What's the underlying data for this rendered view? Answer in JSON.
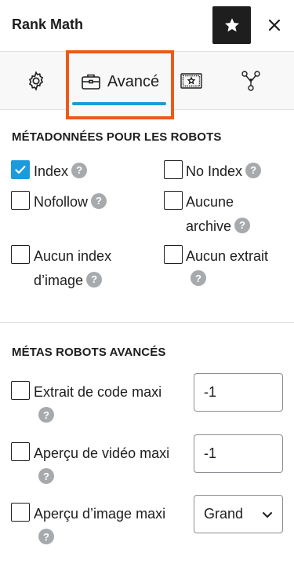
{
  "header": {
    "title": "Rank Math"
  },
  "tabs": {
    "advanced_label": "Avancé"
  },
  "robots_meta": {
    "title": "MÉTADONNÉES POUR LES ROBOTS",
    "index": "Index",
    "no_index": "No Index",
    "nofollow": "Nofollow",
    "no_archive_line1": "Aucune",
    "no_archive_line2": "archive",
    "no_image_index_line1": "Aucun index",
    "no_image_index_line2": "d’image",
    "no_snippet": "Aucun extrait"
  },
  "advanced_robots": {
    "title": "MÉTAS ROBOTS AVANCÉS",
    "max_snippet_label": "Extrait de code maxi",
    "max_snippet_value": "-1",
    "max_video_label": "Aperçu de vidéo maxi",
    "max_video_value": "-1",
    "max_image_label": "Aperçu d’image maxi",
    "max_image_value": "Grand"
  },
  "help_glyph": "?",
  "accent_color": "#1c9bdb",
  "highlight_color": "#ec5a1b"
}
